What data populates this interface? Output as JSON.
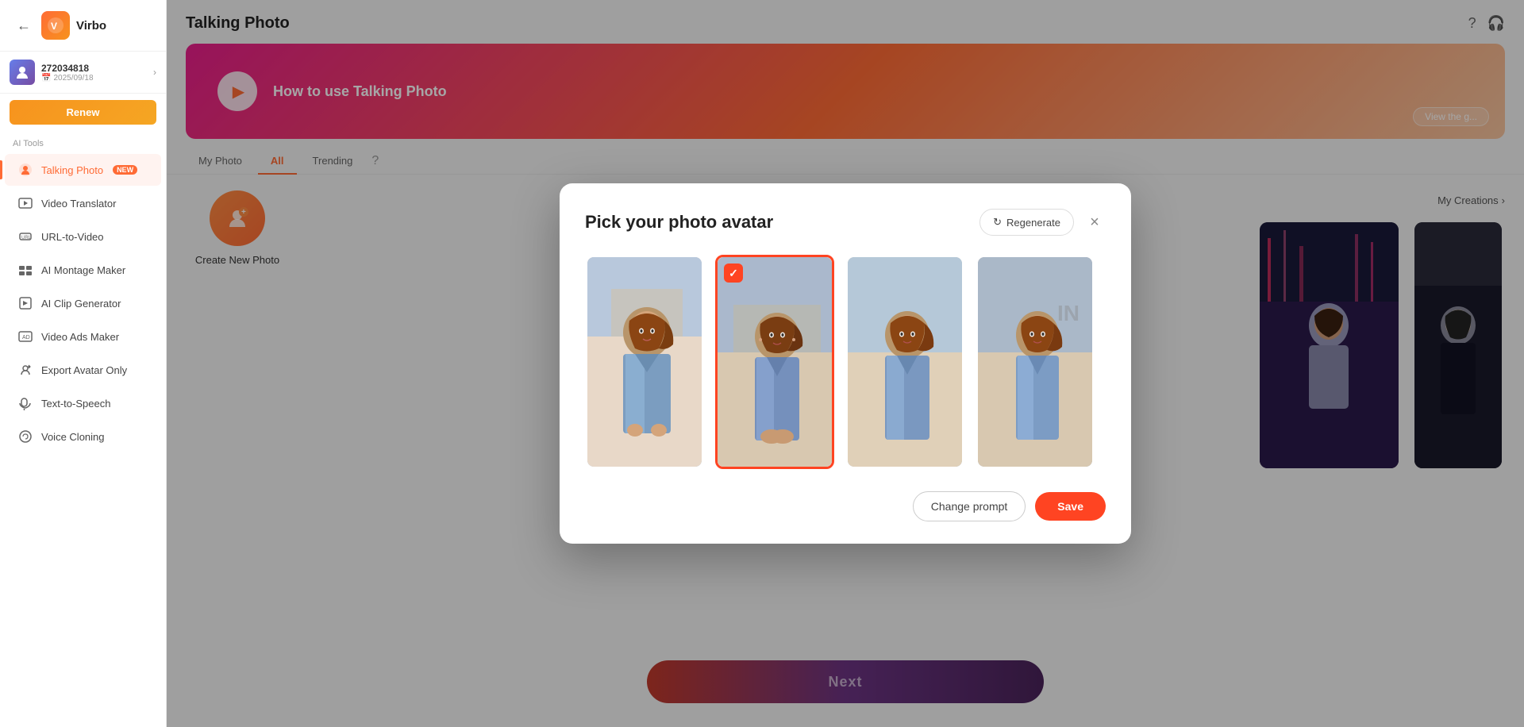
{
  "app": {
    "name": "Virbo",
    "title": "Talking Photo"
  },
  "sidebar": {
    "back_label": "←",
    "user": {
      "id": "272034818",
      "date": "2025/09/18"
    },
    "renew_label": "Renew",
    "ai_tools_label": "AI Tools",
    "nav_items": [
      {
        "id": "talking-photo",
        "label": "Talking Photo",
        "badge": "NEW",
        "active": true
      },
      {
        "id": "video-translator",
        "label": "Video Translator",
        "badge": null,
        "active": false
      },
      {
        "id": "url-to-video",
        "label": "URL-to-Video",
        "badge": null,
        "active": false
      },
      {
        "id": "ai-montage-maker",
        "label": "AI Montage Maker",
        "badge": null,
        "active": false
      },
      {
        "id": "ai-clip-generator",
        "label": "AI Clip Generator",
        "badge": null,
        "active": false
      },
      {
        "id": "video-ads-maker",
        "label": "Video Ads Maker",
        "badge": null,
        "active": false
      },
      {
        "id": "export-avatar-only",
        "label": "Export Avatar Only",
        "badge": null,
        "active": false
      },
      {
        "id": "text-to-speech",
        "label": "Text-to-Speech",
        "badge": null,
        "active": false
      },
      {
        "id": "voice-cloning",
        "label": "Voice Cloning",
        "badge": null,
        "active": false
      }
    ]
  },
  "main": {
    "title": "Talking Photo",
    "banner": {
      "title": "How to use Talking Photo",
      "view_label": "View the g..."
    },
    "tabs": [
      {
        "id": "my-photo",
        "label": "My Photo",
        "active": false
      },
      {
        "id": "all",
        "label": "All",
        "active": true
      },
      {
        "id": "trending",
        "label": "Trending",
        "active": false
      }
    ],
    "create_new_label": "Create New Photo",
    "my_creations_label": "My Creations",
    "next_label": "Next"
  },
  "modal": {
    "title": "Pick your photo avatar",
    "regenerate_label": "Regenerate",
    "close_label": "×",
    "photos": [
      {
        "id": 1,
        "selected": false
      },
      {
        "id": 2,
        "selected": true
      },
      {
        "id": 3,
        "selected": false
      },
      {
        "id": 4,
        "selected": false
      }
    ],
    "change_prompt_label": "Change prompt",
    "save_label": "Save"
  },
  "colors": {
    "accent": "#ff6b35",
    "selected_border": "#ff4422",
    "next_gradient_start": "#c0392b",
    "next_gradient_end": "#4a235a"
  }
}
